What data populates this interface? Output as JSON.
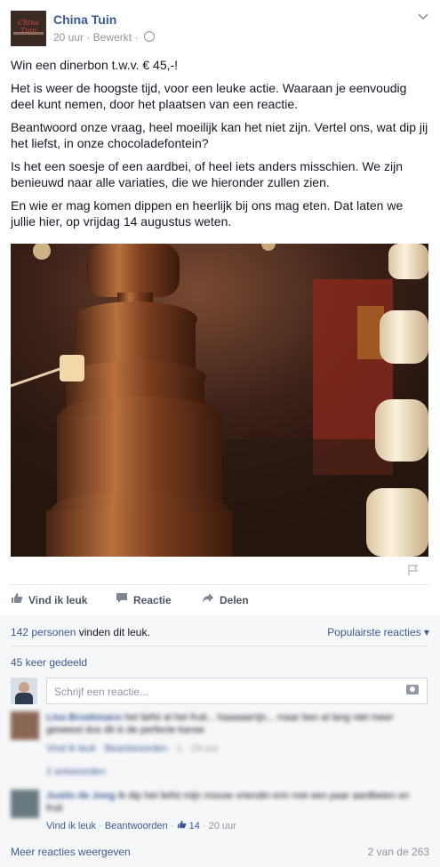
{
  "page": {
    "name": "China Tuin",
    "avatar_icon": "china-tuin-logo",
    "logo_text": "China Tuin"
  },
  "post_meta": {
    "time": "20 uur",
    "separator": "·",
    "edited": "Bewerkt",
    "audience_icon": "globe-icon"
  },
  "post_text": [
    "Win een dinerbon t.w.v. € 45,-!",
    "Het is weer de hoogste tijd, voor een leuke actie. Waaraan je eenvoudig deel kunt nemen, door het plaatsen van een reactie.",
    "Beantwoord onze vraag, heel moeilijk kan het niet zijn. Vertel ons, wat dip jij het liefst, in onze chocoladefontein?",
    "Is het een soesje of een aardbei, of heel iets anders misschien. We zijn benieuwd naar alle variaties, die we hieronder zullen zien.",
    "En wie er mag komen dippen en heerlijk bij ons mag eten. Dat laten we jullie hier, op vrijdag 14 augustus weten."
  ],
  "photo": {
    "subject": "chocolate fountain with white chocolate fountain",
    "colors": {
      "dark": "#2a1610",
      "chocolate": "#6b3a22",
      "highlight": "#c98a5a",
      "white_choc": "#f1e2c5",
      "red_bg": "#8e2a1c"
    }
  },
  "actions": {
    "like": "Vind ik leuk",
    "comment": "Reactie",
    "share": "Delen"
  },
  "likes": {
    "count_link": "142 personen",
    "suffix": " vinden dit leuk."
  },
  "popular": "Populairste reacties ▾",
  "shares": "45 keer gedeeld",
  "reply": {
    "placeholder": "Schrijf een reactie..."
  },
  "comments": [
    {
      "name": "Lisa Broekmans",
      "text": "het liefst al het fruit... haaaaarrijn... maar ben al lang niet meer geweest dus dit is de perfecte kanse",
      "like": "Vind ik leuk",
      "reply": "Beantwoorden",
      "likes": "1",
      "time": "19 uur",
      "replies": "2 antwoorden"
    },
    {
      "name": "Justin de Jong",
      "text": "Ik dip het liefst mijn mouse vriendin erin met een paar aardbeien en fruit",
      "like": "Vind ik leuk",
      "reply": "Beantwoorden",
      "likes": "14",
      "time": "20 uur"
    }
  ],
  "footer": {
    "more": "Meer reacties weergeven",
    "count": "2 van de 263"
  },
  "colors": {
    "link": "#3b5998",
    "meta": "#90949c",
    "grey_bg": "#f6f7f8"
  }
}
